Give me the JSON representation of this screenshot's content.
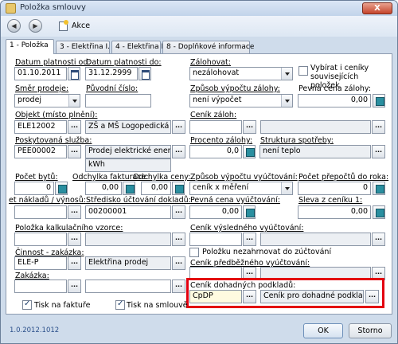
{
  "window": {
    "title": "Položka smlouvy",
    "close": "X"
  },
  "toolbar": {
    "back": "◀",
    "forward": "▶",
    "akce": "Akce"
  },
  "tabs": [
    "1 - Položka",
    "3 - Elektřina I.",
    "4 - Elektřina II.",
    "8 - Doplňkové informace"
  ],
  "form": {
    "datum_od_label": "Datum platnosti od:",
    "datum_od": "01.10.2011",
    "datum_do_label": "Datum platnosti do:",
    "datum_do": "31.12.2999",
    "zalohovat_label": "Zálohovat:",
    "zalohovat": "nezálohovat",
    "vybirat_label": "Vybírat i ceníky souvisejících položek",
    "smer_label": "Směr prodeje:",
    "smer": "prodej",
    "puvodni_label": "Původní číslo:",
    "puvodni": "",
    "zpusob_zalohy_label": "Způsob výpočtu zálohy:",
    "zpusob_zalohy": "není výpočet",
    "pevna_zalohy_label": "Pevná cena zálohy:",
    "pevna_zalohy": "0,00",
    "objekt_label": "Objekt (místo plnění):",
    "objekt_code": "ELE12002",
    "objekt_name": "ZŠ a MŠ Logopedická",
    "cenik_zaloh_label": "Ceník záloh:",
    "cenik_zaloh": "",
    "sluzba_label": "Poskytovaná služba:",
    "sluzba_code": "PEE00002",
    "sluzba_name": "Prodej elektrické energie",
    "sluzba_unit": "kWh",
    "procento_label": "Procento zálohy:",
    "procento": "0,0",
    "struktura_label": "Struktura spotřeby:",
    "struktura": "není teplo",
    "pocet_bytu_label": "Počet bytů:",
    "pocet_bytu": "0",
    "odchylka_f_label": "Odchylka fakturace:",
    "odchylka_f": "0,00",
    "odchylka_c_label": "Odchylka ceny:",
    "odchylka_c": "0,00",
    "zpusob_vyuct_label": "Způsob výpočtu vyúčtování:",
    "zpusob_vyuct": "ceník x měření",
    "pocet_prepoctu_label": "Počet přepočtů do roka:",
    "pocet_prepoctu": "0",
    "stred_nakl_label": "et nákladů / výnosů:",
    "stred_nakl": "",
    "stredisko_label": "Středisko účtování dokladů:",
    "stredisko": "00200001",
    "pevna_vyuct_label": "Pevná cena vyúčtování:",
    "pevna_vyuct": "0,00",
    "sleva_label": "Sleva z ceníku 1:",
    "sleva": "0,00",
    "kalk_label": "Položka kalkulačního vzorce:",
    "kalk": "",
    "cenik_vysl_label": "Ceník výsledného vyúčtování:",
    "cenik_vysl": "",
    "nezahrnovat_label": "Položku nezahrnovat do zúčtování",
    "cinnost_label": "Činnost - zakázka:",
    "cinnost_code": "ELE-P",
    "cinnost_name": "Elektřina prodej",
    "cenik_pred_label": "Ceník předběžného vyúčtování:",
    "cenik_pred": "",
    "zakazka_label": "Zakázka:",
    "zakazka": "",
    "zakazka2": "",
    "cenik_dohad_label": "Ceník dohadných podkladů:",
    "cenik_dohad_code": "CpDP",
    "cenik_dohad_name": "Ceník pro dohadné podklady",
    "tisk_faktura_label": "Tisk na faktuře",
    "tisk_smlouva_label": "Tisk na smlouvě"
  },
  "footer": {
    "version": "1.0.2012.1012",
    "ok": "OK",
    "storno": "Storno"
  },
  "ellipsis": "...",
  "colors": {
    "highlight": "#e3000f",
    "window": "#cfdceb"
  }
}
